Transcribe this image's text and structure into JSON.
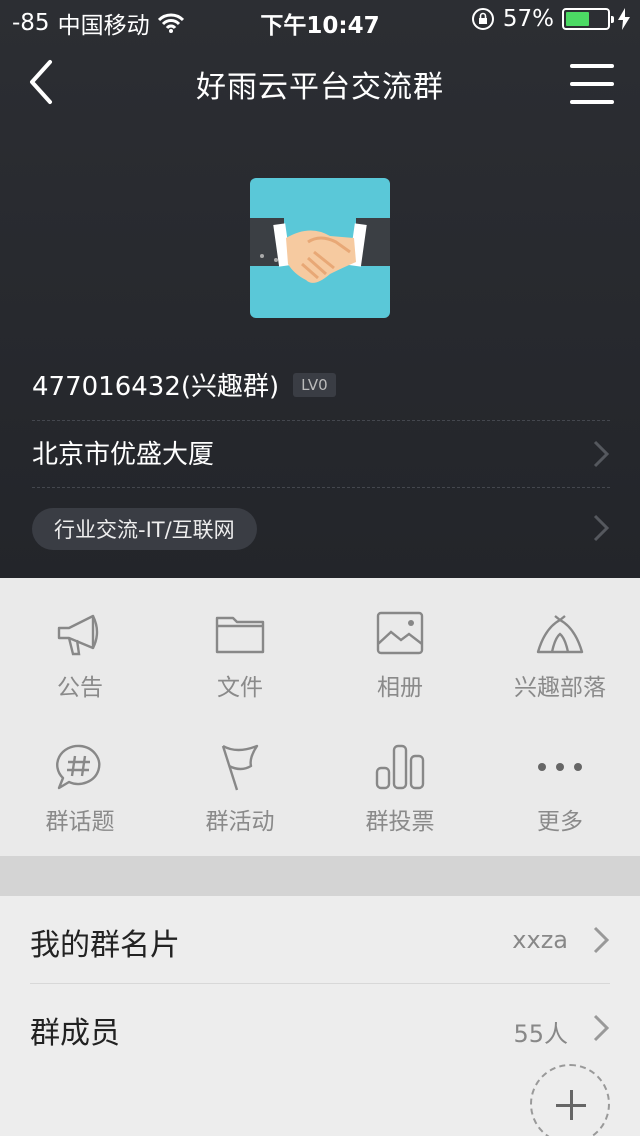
{
  "status": {
    "signal": "-85",
    "carrier": "中国移动",
    "time": "下午10:47",
    "battery": "57%",
    "battery_level": 0.57
  },
  "nav": {
    "title": "好雨云平台交流群"
  },
  "group": {
    "id_text": "477016432(兴趣群)",
    "level": "LV0",
    "address": "北京市优盛大厦",
    "category": "行业交流-IT/互联网"
  },
  "features": [
    {
      "label": "公告",
      "icon": "megaphone-icon"
    },
    {
      "label": "文件",
      "icon": "folder-icon"
    },
    {
      "label": "相册",
      "icon": "album-icon"
    },
    {
      "label": "兴趣部落",
      "icon": "tribe-icon"
    },
    {
      "label": "群话题",
      "icon": "topic-icon"
    },
    {
      "label": "群活动",
      "icon": "flag-icon"
    },
    {
      "label": "群投票",
      "icon": "vote-icon"
    },
    {
      "label": "更多",
      "icon": "more-icon"
    }
  ],
  "list": {
    "card": {
      "label": "我的群名片",
      "value": "xxza"
    },
    "members": {
      "label": "群成员",
      "value": "55人"
    }
  },
  "colors": {
    "header_bg": "#2c2e33",
    "battery": "#4cd964",
    "avatar_bg": "#5ac8d8"
  }
}
